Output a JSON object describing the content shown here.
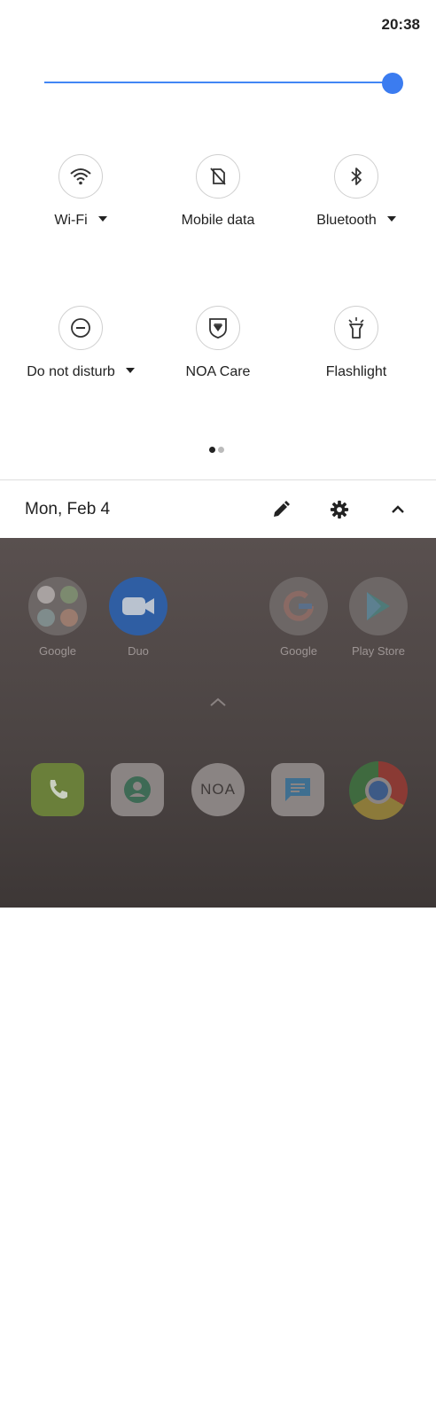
{
  "status": {
    "time": "20:38"
  },
  "brightness": {
    "level": 1.0
  },
  "tiles": [
    {
      "label": "Wi-Fi",
      "icon": "wifi-icon",
      "has_menu": true
    },
    {
      "label": "Mobile data",
      "icon": "mobile-data-off-icon",
      "has_menu": false
    },
    {
      "label": "Bluetooth",
      "icon": "bluetooth-icon",
      "has_menu": true
    },
    {
      "label": "Do not disturb",
      "icon": "do-not-disturb-icon",
      "has_menu": true
    },
    {
      "label": "NOA Care",
      "icon": "noa-care-icon",
      "has_menu": false
    },
    {
      "label": "Flashlight",
      "icon": "flashlight-icon",
      "has_menu": false
    }
  ],
  "footer": {
    "date": "Mon, Feb 4"
  },
  "home": {
    "apps": [
      {
        "name": "Google",
        "icon": "google-folder-icon"
      },
      {
        "name": "Duo",
        "icon": "duo-icon"
      },
      {
        "name": "Google",
        "icon": "google-icon"
      },
      {
        "name": "Play Store",
        "icon": "play-store-icon"
      }
    ],
    "noa_text": "NOA"
  },
  "colors": {
    "accent": "#3b7cf0",
    "wallpaper": "#4a4342"
  }
}
